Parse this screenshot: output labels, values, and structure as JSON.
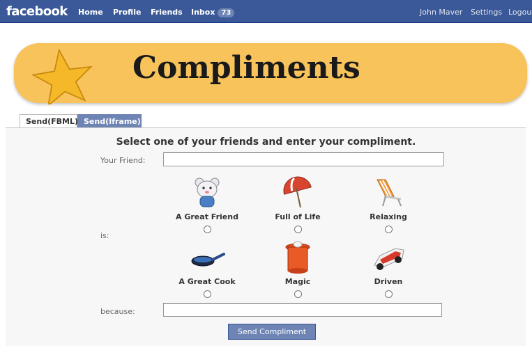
{
  "header": {
    "logo": "facebook",
    "nav": [
      "Home",
      "Profile",
      "Friends",
      "Inbox"
    ],
    "inbox_count": "73",
    "user_name": "John Maver",
    "settings": "Settings",
    "logout": "Logout"
  },
  "banner": {
    "title": "Compliments"
  },
  "tabs": [
    "Send(FBML)",
    "Send(Iframe)"
  ],
  "form": {
    "heading": "Select one of your friends and enter your compliment.",
    "friend_label": "Your Friend:",
    "friend_value": "",
    "is_label": "is:",
    "because_label": "because:",
    "because_value": "",
    "options": [
      {
        "label": "A Great Friend",
        "icon": "teddy-bear-icon"
      },
      {
        "label": "Full of Life",
        "icon": "umbrella-icon"
      },
      {
        "label": "Relaxing",
        "icon": "beach-chair-icon"
      },
      {
        "label": "A Great Cook",
        "icon": "frying-pan-icon"
      },
      {
        "label": "Magic",
        "icon": "magic-hat-icon"
      },
      {
        "label": "Driven",
        "icon": "race-car-icon"
      }
    ],
    "submit": "Send Compliment"
  },
  "colors": {
    "header_bg": "#3b5998",
    "banner_bg": "#f7c35a",
    "tab_inactive_bg": "#6d84b4",
    "button_bg": "#6d84b4"
  }
}
